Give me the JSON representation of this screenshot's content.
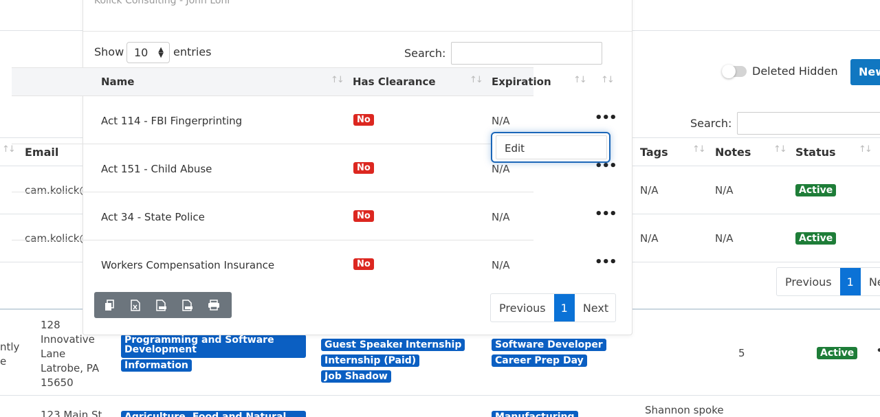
{
  "bg": {
    "toggle_label": "Deleted Hidden",
    "new_button": "New",
    "search_label": "Search:",
    "columns": {
      "email": "Email",
      "tags": "Tags",
      "notes": "Notes",
      "status": "Status"
    },
    "rows": [
      {
        "email": "cam.kolick@",
        "tags": "N/A",
        "notes": "N/A",
        "status": "Active"
      },
      {
        "email": "cam.kolick@",
        "tags": "N/A",
        "notes": "N/A",
        "status": "Active"
      }
    ],
    "pager": {
      "previous": "Previous",
      "page": "1",
      "next": "Ne"
    },
    "lower_row": {
      "left_fragment_1": "ntly",
      "left_fragment_2": "e",
      "address": [
        "128",
        "Innovative",
        "Lane",
        "Latrobe, PA",
        "15650"
      ],
      "industries": [
        "Programming and Software Development",
        "Information"
      ],
      "activities": [
        "Guest Speaker",
        "Internship",
        "Internship (Paid)",
        "Job Shadow"
      ],
      "careers": [
        "Software Developer",
        "Career Prep Day"
      ],
      "count": "5",
      "status": "Active",
      "more": "•"
    },
    "next_row": {
      "address_partial": "123 Main St",
      "industry_partial": "Agriculture, Food and Natural",
      "career_partial": "Manufacturing",
      "note_partial": "Shannon spoke"
    }
  },
  "modal": {
    "subtitle": "Kolick Consulting - John Lohr",
    "show_label": "Show",
    "entries_value": "10",
    "entries_label": "entries",
    "search_label": "Search:",
    "columns": {
      "name": "Name",
      "clearance": "Has Clearance",
      "expiration": "Expiration"
    },
    "rows": [
      {
        "name": "Act 114 - FBI Fingerprinting",
        "clearance": "No",
        "expiration": "N/A"
      },
      {
        "name": "Act 151 - Child Abuse",
        "clearance": "No",
        "expiration": "N/A"
      },
      {
        "name": "Act 34 - State Police",
        "clearance": "No",
        "expiration": "N/A"
      },
      {
        "name": "Workers Compensation Insurance",
        "clearance": "No",
        "expiration": "N/A"
      }
    ],
    "dropdown_edit": "Edit",
    "pager": {
      "previous": "Previous",
      "page": "1",
      "next": "Next"
    },
    "toolbar_icons": [
      "copy-icon",
      "excel-icon",
      "csv-icon",
      "pdf-icon",
      "print-icon"
    ]
  }
}
